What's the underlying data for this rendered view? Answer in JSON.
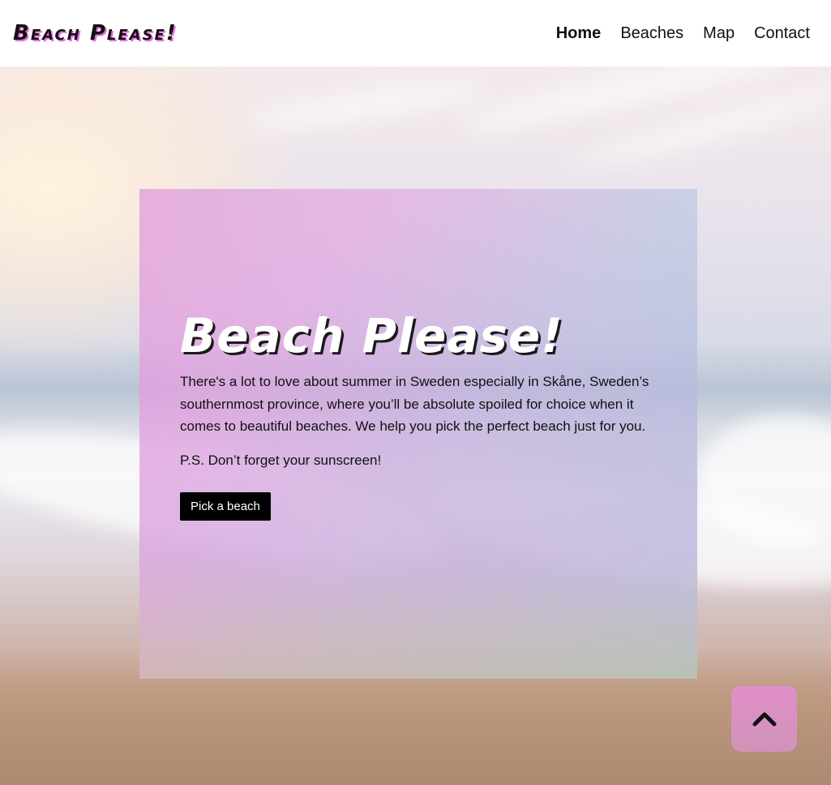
{
  "header": {
    "logo": "Beach Please!",
    "nav": [
      {
        "label": "Home",
        "active": true
      },
      {
        "label": "Beaches",
        "active": false
      },
      {
        "label": "Map",
        "active": false
      },
      {
        "label": "Contact",
        "active": false
      }
    ]
  },
  "hero": {
    "title": "Beach Please!",
    "paragraphs": [
      "There's a lot to love about summer in Sweden especially in Skåne, Sweden’s southernmost province, where you’ll be absolute spoiled for choice when it comes to beautiful beaches. We help you pick the perfect beach just for you.",
      "P.S. Don’t forget your sunscreen!"
    ],
    "button_label": "Pick a beach"
  },
  "back_to_top": {
    "icon": "chevron-up-icon"
  },
  "colors": {
    "accent_pink": "#e96fe0",
    "card_teal": "#8cd8dc",
    "button_bg": "#000000"
  }
}
